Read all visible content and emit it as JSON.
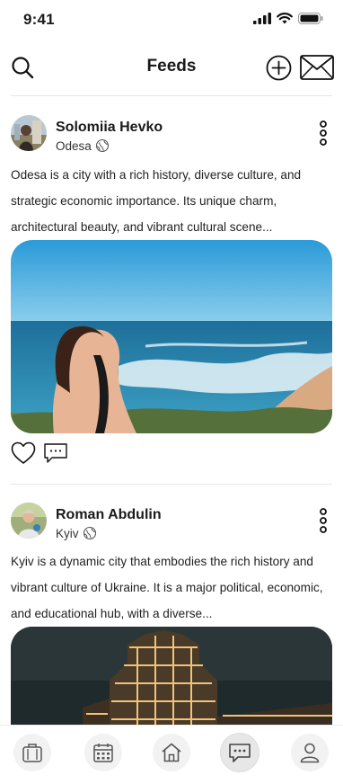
{
  "status": {
    "time": "9:41"
  },
  "header": {
    "title": "Feeds"
  },
  "posts": [
    {
      "author": "Solomiia Hevko",
      "location": "Odesa",
      "text": "Odesa is a city with a rich history, diverse culture, and strategic economic importance. Its unique charm, architectural beauty, and vibrant cultural scene..."
    },
    {
      "author": "Roman Abdulin",
      "location": "Kyiv",
      "text": "Kyiv is a dynamic city that embodies the rich history and vibrant culture of Ukraine. It is a major political, economic, and educational hub, with a diverse..."
    }
  ],
  "nav": {
    "items": [
      "briefcase-icon",
      "calendar-icon",
      "home-icon",
      "chat-icon",
      "profile-icon"
    ],
    "active": "chat-icon"
  }
}
